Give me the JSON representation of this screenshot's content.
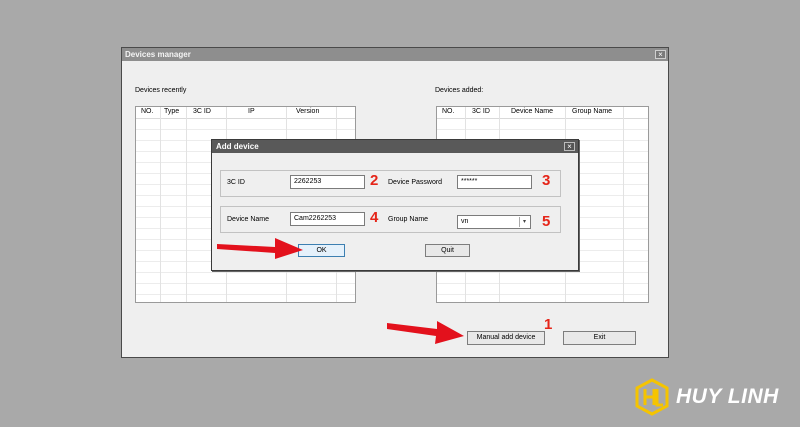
{
  "devices_manager": {
    "title": "Devices manager",
    "close_glyph": "×",
    "recent": {
      "label": "Devices recently",
      "columns": [
        "NO.",
        "Type",
        "3C ID",
        "IP",
        "Version"
      ]
    },
    "added": {
      "label": "Devices added:",
      "columns": [
        "NO.",
        "3C ID",
        "Device Name",
        "Group Name"
      ]
    },
    "manual_add_label": "Manual add device",
    "exit_label": "Exit"
  },
  "add_device": {
    "title": "Add device",
    "close_glyph": "×",
    "id_label": "3C ID",
    "id_value": "2262253",
    "password_label": "Device Password",
    "password_value": "******",
    "name_label": "Device Name",
    "name_value": "Cam2262253",
    "group_label": "Group Name",
    "group_value": "vn",
    "ok_label": "OK",
    "quit_label": "Quit"
  },
  "annotations": {
    "step_manual_add": "1",
    "step_id": "2",
    "step_password": "3",
    "step_name": "4",
    "step_group": "5",
    "arrow_color": "#e3111c",
    "number_color": "#e52519"
  },
  "watermark": {
    "text": "HUY LINH",
    "logo_letters": "HL",
    "logo_color": "#f5c400"
  }
}
